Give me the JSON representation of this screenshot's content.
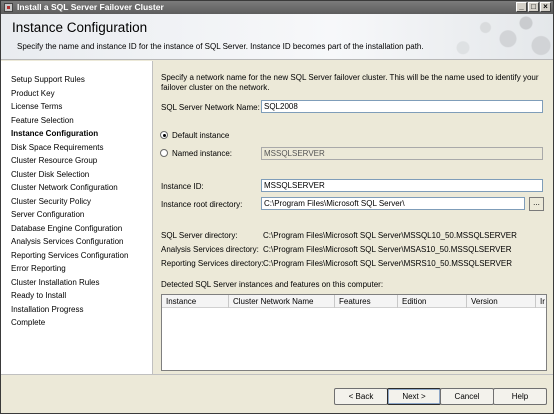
{
  "window": {
    "title": "Install a SQL Server Failover Cluster",
    "controls": {
      "minimize": "_",
      "maximize": "□",
      "close": "×"
    }
  },
  "header": {
    "title": "Instance Configuration",
    "subtitle": "Specify the name and instance ID for the instance of SQL Server. Instance ID becomes part of the installation path."
  },
  "sidebar": {
    "items": [
      {
        "label": "Setup Support Rules",
        "active": false
      },
      {
        "label": "Product Key",
        "active": false
      },
      {
        "label": "License Terms",
        "active": false
      },
      {
        "label": "Feature Selection",
        "active": false
      },
      {
        "label": "Instance Configuration",
        "active": true
      },
      {
        "label": "Disk Space Requirements",
        "active": false
      },
      {
        "label": "Cluster Resource Group",
        "active": false
      },
      {
        "label": "Cluster Disk Selection",
        "active": false
      },
      {
        "label": "Cluster Network Configuration",
        "active": false
      },
      {
        "label": "Cluster Security Policy",
        "active": false
      },
      {
        "label": "Server Configuration",
        "active": false
      },
      {
        "label": "Database Engine Configuration",
        "active": false
      },
      {
        "label": "Analysis Services Configuration",
        "active": false
      },
      {
        "label": "Reporting Services Configuration",
        "active": false
      },
      {
        "label": "Error Reporting",
        "active": false
      },
      {
        "label": "Cluster Installation Rules",
        "active": false
      },
      {
        "label": "Ready to Install",
        "active": false
      },
      {
        "label": "Installation Progress",
        "active": false
      },
      {
        "label": "Complete",
        "active": false
      }
    ]
  },
  "main": {
    "intro_line1": "Specify a network name for the new SQL Server failover cluster. This will be the name used to identify your",
    "intro_line2": "failover cluster on the network.",
    "network_name_label": "SQL Server Network Name:",
    "network_name_value": "SQL2008",
    "default_instance_label": "Default instance",
    "named_instance_label": "Named instance:",
    "named_instance_value": "MSSQLSERVER",
    "instance_id_label": "Instance ID:",
    "instance_id_value": "MSSQLSERVER",
    "instance_root_label": "Instance root directory:",
    "instance_root_value": "C:\\Program Files\\Microsoft SQL Server\\",
    "browse_label": "...",
    "sql_dir_label": "SQL Server directory:",
    "sql_dir_value": "C:\\Program Files\\Microsoft SQL Server\\MSSQL10_50.MSSQLSERVER",
    "as_dir_label": "Analysis Services directory:",
    "as_dir_value": "C:\\Program Files\\Microsoft SQL Server\\MSAS10_50.MSSQLSERVER",
    "rs_dir_label": "Reporting Services directory:",
    "rs_dir_value": "C:\\Program Files\\Microsoft SQL Server\\MSRS10_50.MSSQLSERVER",
    "detected_label": "Detected SQL Server instances and features on this computer:",
    "table": {
      "columns": [
        "Instance",
        "Cluster Network Name",
        "Features",
        "Edition",
        "Version",
        "Ir"
      ],
      "rows": []
    }
  },
  "footer": {
    "back": "< Back",
    "next": "Next >",
    "cancel": "Cancel",
    "help": "Help"
  }
}
